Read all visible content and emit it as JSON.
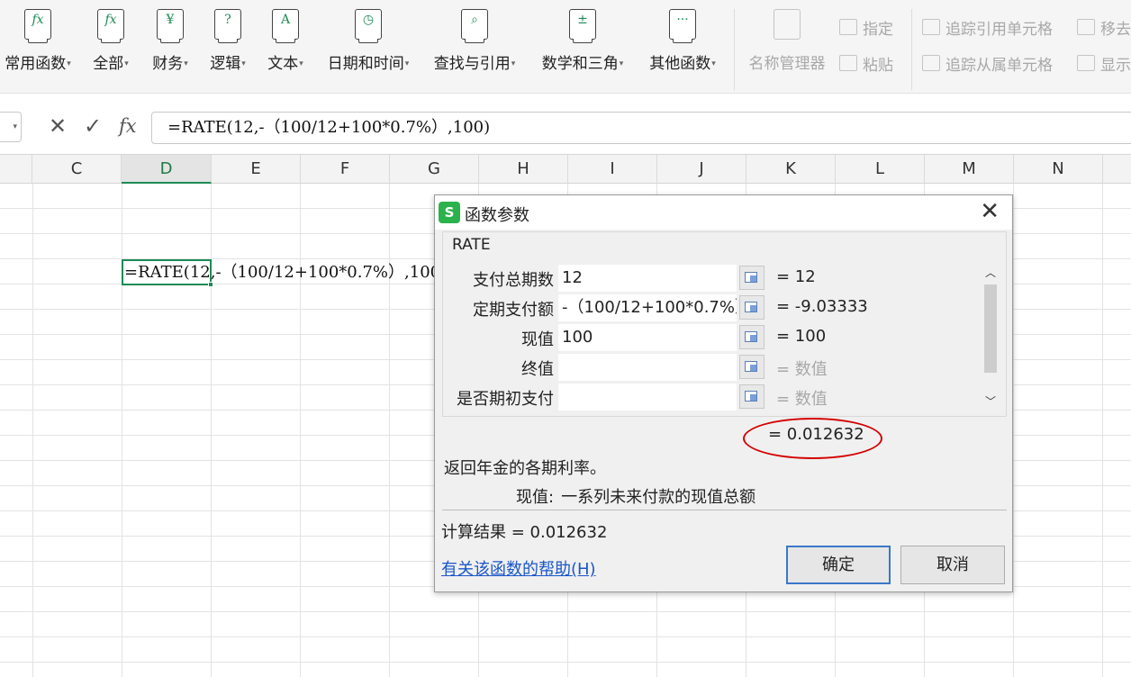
{
  "ribbon": {
    "buttons": [
      {
        "label": "常用函数",
        "icon": "function-star-icon",
        "glyph": "fx"
      },
      {
        "label": "全部",
        "icon": "function-all-icon",
        "glyph": "fx"
      },
      {
        "label": "财务",
        "icon": "finance-icon",
        "glyph": "¥"
      },
      {
        "label": "逻辑",
        "icon": "logic-icon",
        "glyph": "?"
      },
      {
        "label": "文本",
        "icon": "text-icon",
        "glyph": "A"
      },
      {
        "label": "日期和时间",
        "icon": "clock-icon",
        "glyph": "◷"
      },
      {
        "label": "查找与引用",
        "icon": "lookup-icon",
        "glyph": "⌕"
      },
      {
        "label": "数学和三角",
        "icon": "math-icon",
        "glyph": "±"
      },
      {
        "label": "其他函数",
        "icon": "more-functions-icon",
        "glyph": "···"
      }
    ],
    "name_manager": "名称管理器",
    "specify": "指定",
    "paste": "粘贴",
    "trace_precedents": "追踪引用单元格",
    "trace_dependents": "追踪从属单元格",
    "remove_arrows": "移去",
    "show": "显示"
  },
  "formula_bar": {
    "cancel_icon": "✕",
    "confirm_icon": "✓",
    "fx_label": "fx",
    "formula": "=RATE(12,-（100/12+100*0.7%）,100)"
  },
  "grid": {
    "columns": [
      "C",
      "D",
      "E",
      "F",
      "G",
      "H",
      "I",
      "J",
      "K",
      "L",
      "M",
      "N"
    ],
    "active_column": "D",
    "cell_text": "=RATE(12,-（100/12+100*0.7%）,100)"
  },
  "dialog": {
    "title": "函数参数",
    "logo": "S",
    "close_icon": "✕",
    "function_name": "RATE",
    "args": [
      {
        "label": "支付总期数",
        "value": "12",
        "result": "= 12",
        "hint": false
      },
      {
        "label": "定期支付额",
        "value": "-（100/12+100*0.7%）",
        "result": "= -9.03333",
        "hint": false
      },
      {
        "label": "现值",
        "value": "100",
        "result": "= 100",
        "hint": false
      },
      {
        "label": "终值",
        "value": "",
        "result": "= 数值",
        "hint": true
      },
      {
        "label": "是否期初支付",
        "value": "",
        "result": "= 数值",
        "hint": true
      }
    ],
    "overall_result": "= 0.012632",
    "description": "返回年金的各期利率。",
    "arg_desc_key": "现值:",
    "arg_desc_text": "一系列未来付款的现值总额",
    "calc_result": "计算结果 = 0.012632",
    "help_link": "有关该函数的帮助(H)",
    "ok_label": "确定",
    "cancel_label": "取消",
    "scroll_up_icon": "︿",
    "scroll_down_icon": "﹀"
  },
  "colors": {
    "accent_green": "#1e8a55",
    "highlight_circle": "#d40000",
    "link_blue": "#1a57c8"
  }
}
